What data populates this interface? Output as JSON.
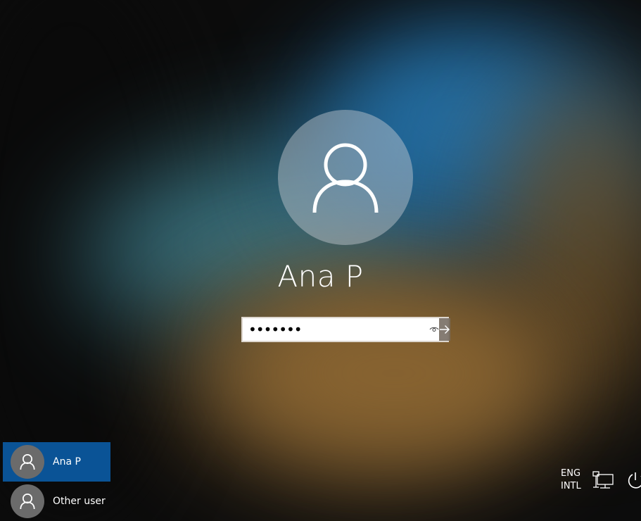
{
  "login": {
    "user_name": "Ana P",
    "password_mask": "•••••••"
  },
  "user_list": [
    {
      "label": "Ana P",
      "selected": true
    },
    {
      "label": "Other user",
      "selected": false
    }
  ],
  "tray": {
    "lang_line1": "ENG",
    "lang_line2": "INTL"
  },
  "colors": {
    "selected_tile": "#0a5396",
    "tile_avatar": "#6b6b6b",
    "text": "#ffffff"
  }
}
